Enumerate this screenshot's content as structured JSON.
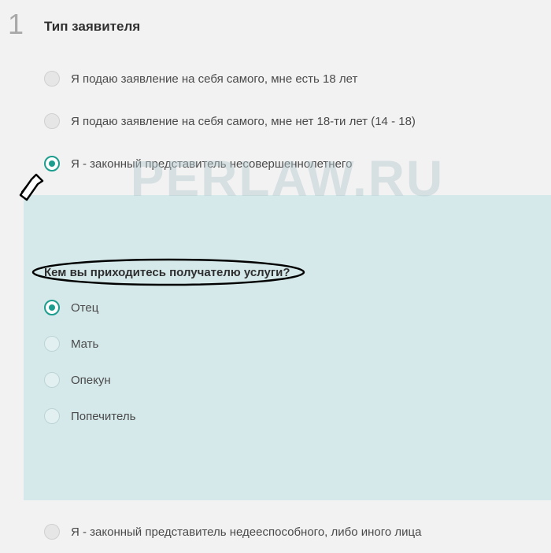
{
  "step_number": "1",
  "step_title": "Тип заявителя",
  "watermark": "PERLAW.RU",
  "options": [
    {
      "label": "Я подаю заявление на себя самого, мне есть 18 лет",
      "selected": false
    },
    {
      "label": "Я подаю заявление на себя самого, мне нет 18-ти лет (14 - 18)",
      "selected": false
    },
    {
      "label": "Я - законный представитель несовершеннолетнего",
      "selected": true
    },
    {
      "label": "Я - законный представитель недееспособного, либо иного лица",
      "selected": false
    }
  ],
  "sub_question": "Кем вы приходитесь получателю услуги?",
  "sub_options": [
    {
      "label": "Отец",
      "selected": true
    },
    {
      "label": "Мать",
      "selected": false
    },
    {
      "label": "Опекун",
      "selected": false
    },
    {
      "label": "Попечитель",
      "selected": false
    }
  ]
}
